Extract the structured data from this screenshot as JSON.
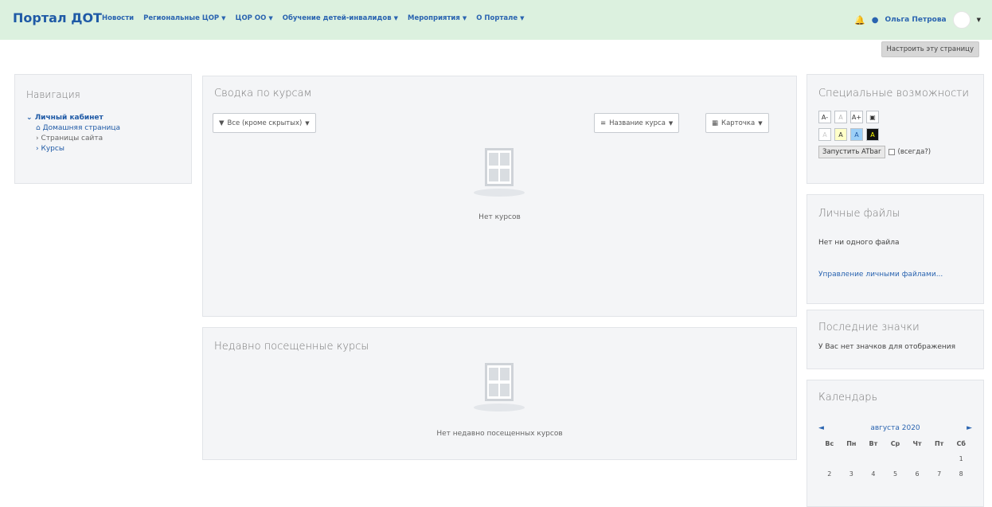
{
  "navbar": {
    "brand": "Портал ДОТ",
    "menu": [
      {
        "label": "Новости",
        "dropdown": false
      },
      {
        "label": "Региональные ЦОР",
        "dropdown": true
      },
      {
        "label": "ЦОР ОО",
        "dropdown": true
      },
      {
        "label": "Обучение детей-инвалидов",
        "dropdown": true
      },
      {
        "label": "Мероприятия",
        "dropdown": true
      },
      {
        "label": "О Портале",
        "dropdown": true
      }
    ],
    "user_name": "Ольга Петрова",
    "customize_button": "Настроить эту страницу"
  },
  "navigation": {
    "title": "Навигация",
    "root": "Личный кабинет",
    "items": [
      "Домашняя страница",
      "Страницы сайта",
      "Курсы"
    ]
  },
  "course_overview": {
    "title": "Сводка по курсам",
    "filter_label": "Все (кроме скрытых)",
    "sort_label": "Название курса",
    "view_label": "Карточка",
    "empty_text": "Нет курсов"
  },
  "recent_courses": {
    "title": "Недавно посещенные курсы",
    "empty_text": "Нет недавно посещенных курсов"
  },
  "accessibility": {
    "title": "Специальные возможности",
    "row1": [
      "A-",
      "A",
      "A+"
    ],
    "row2": [
      "A",
      "A",
      "A",
      "A"
    ],
    "atbar_button": "Запустить ATbar",
    "atbar_checkbox_label": "(всегда?)"
  },
  "private_files": {
    "title": "Личные файлы",
    "empty_text": "Нет ни одного файла",
    "manage_link": "Управление личными файлами..."
  },
  "badges": {
    "title": "Последние значки",
    "empty_text": "У Вас нет значков для отображения"
  },
  "calendar": {
    "title": "Календарь",
    "month": "августа 2020",
    "prev": "◄",
    "next": "►",
    "day_names": [
      "Вс",
      "Пн",
      "Вт",
      "Ср",
      "Чт",
      "Пт",
      "Сб"
    ],
    "week1": [
      "",
      "",
      "",
      "",
      "",
      "",
      "1"
    ],
    "week2": [
      "2",
      "3",
      "4",
      "5",
      "6",
      "7",
      "8"
    ]
  },
  "colors": {
    "navbar_bg": "#dcf1df",
    "brand": "#1f5aa6",
    "block_bg": "#f4f5f7"
  }
}
